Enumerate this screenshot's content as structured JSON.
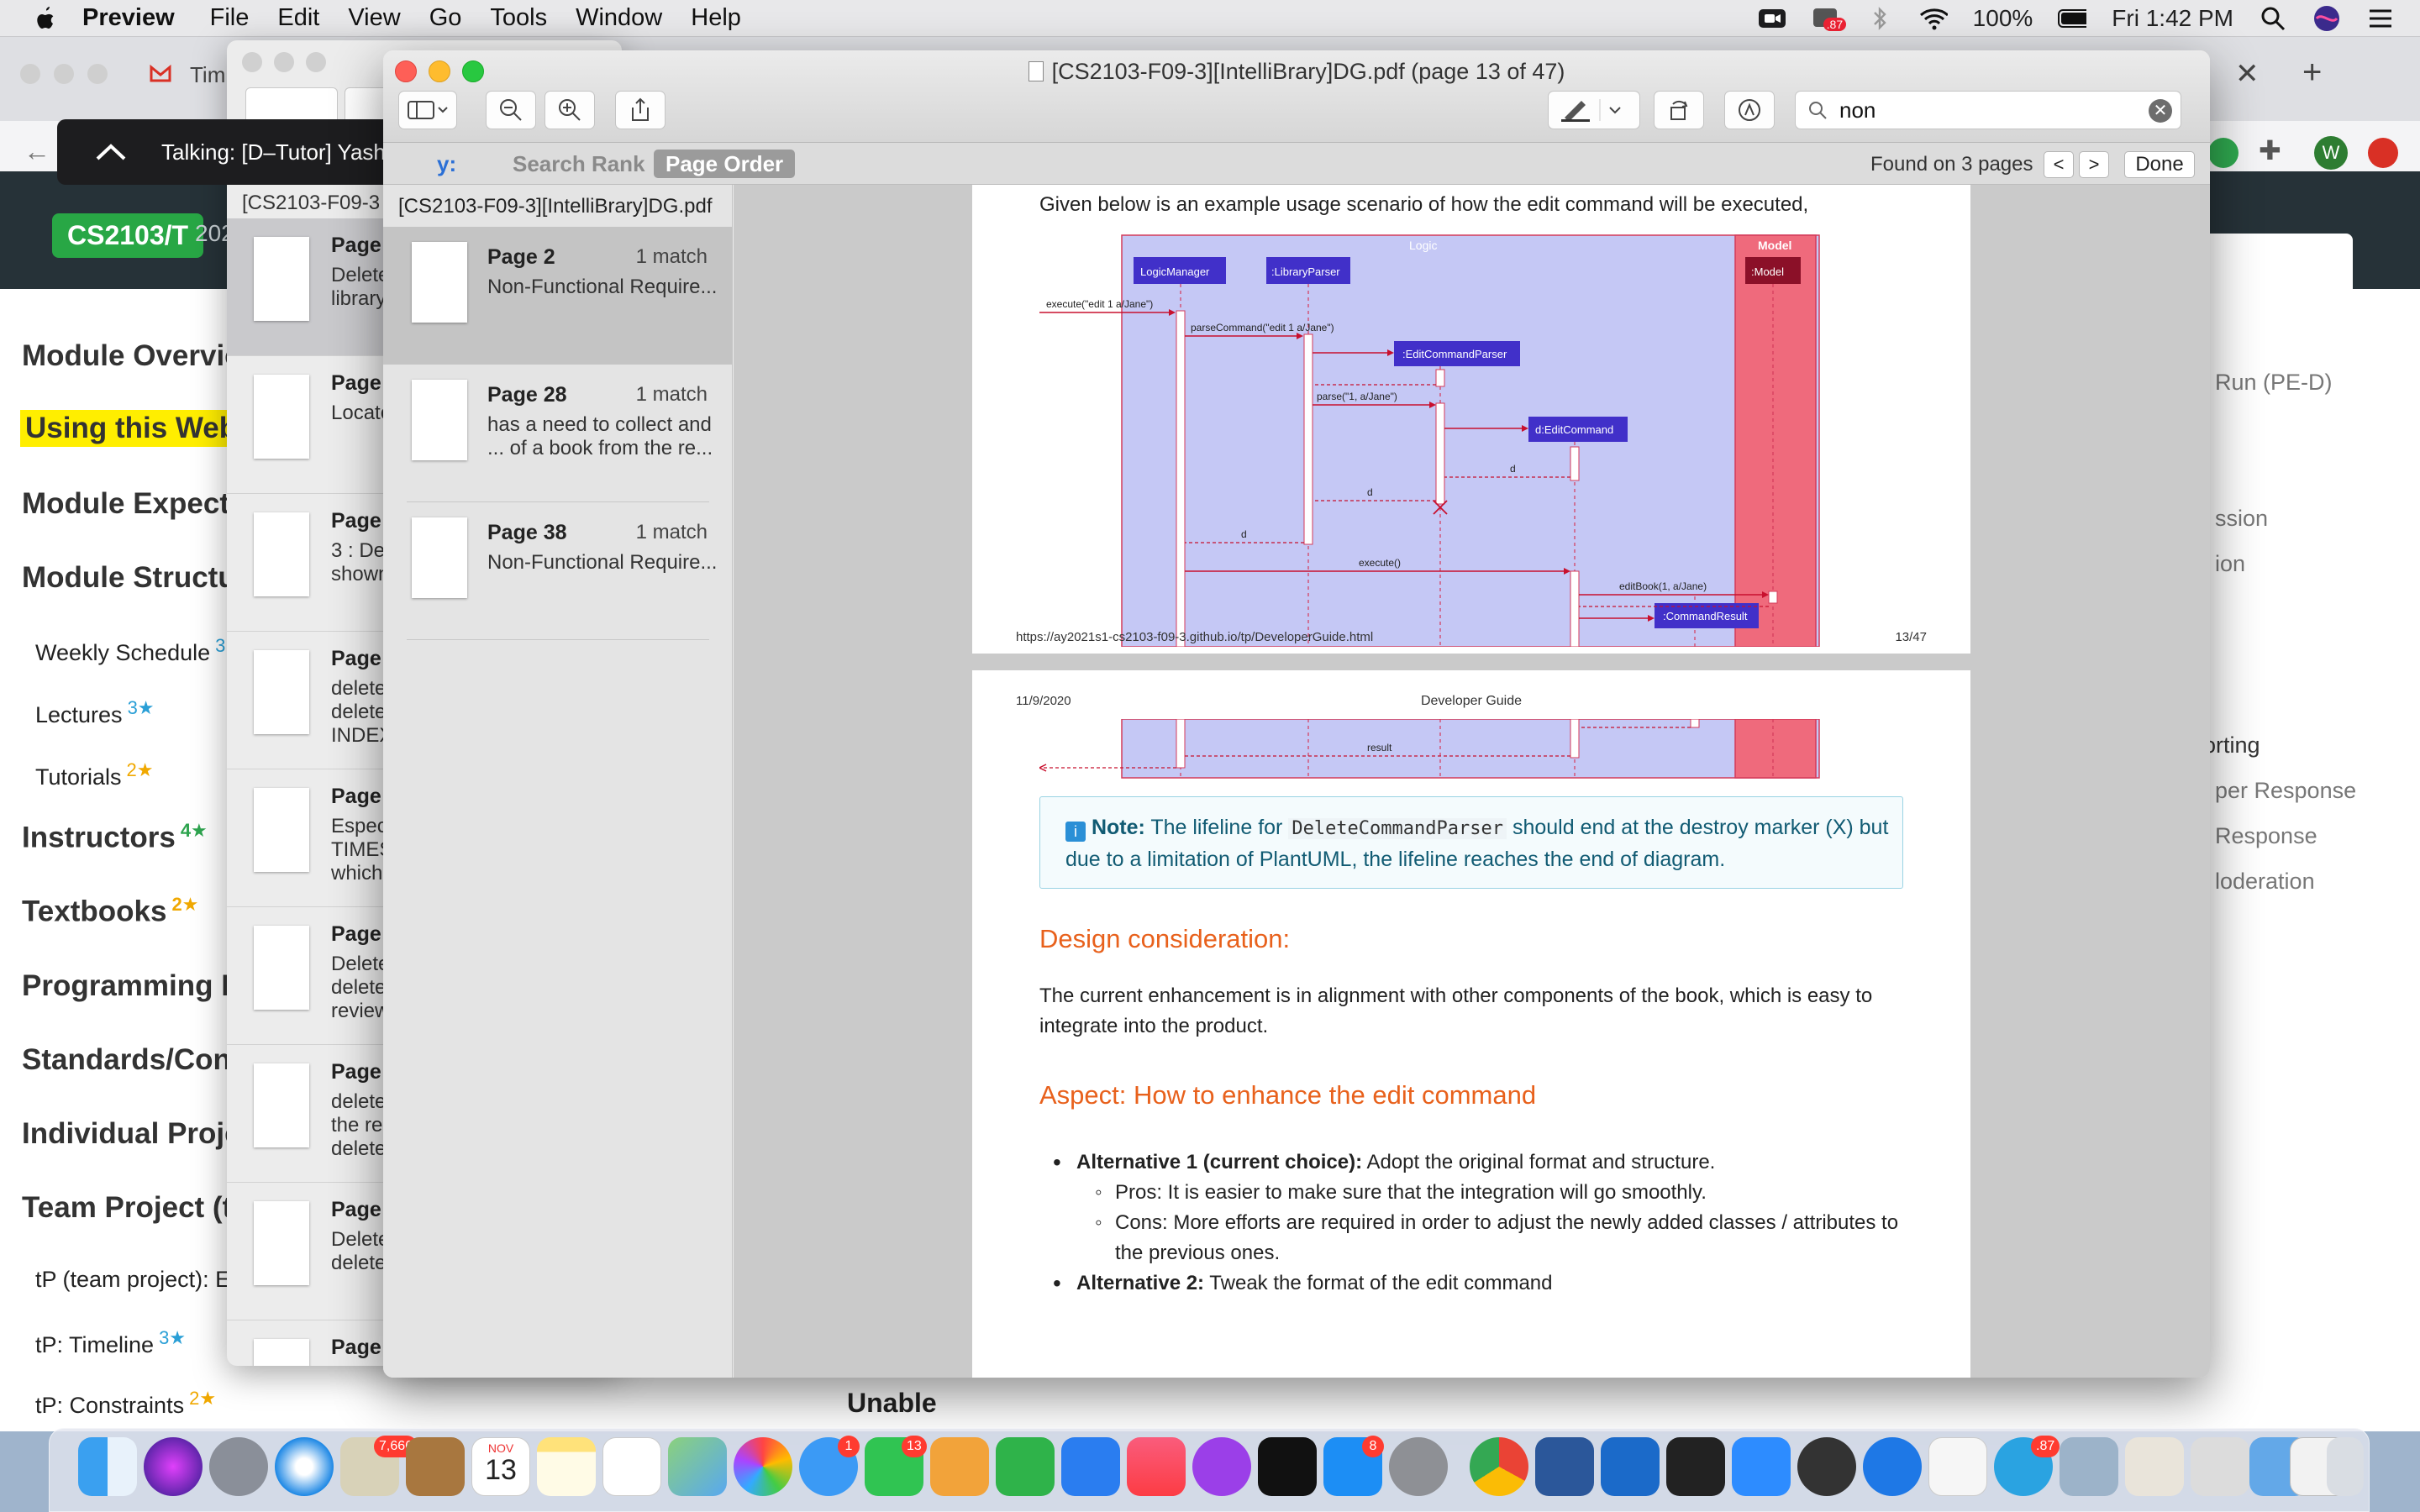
{
  "menubar": {
    "app_name": "Preview",
    "items": [
      "File",
      "Edit",
      "View",
      "Go",
      "Tools",
      "Window",
      "Help"
    ],
    "battery": "100%",
    "clock": "Fri 1:42 PM",
    "zoom_badge": ".87"
  },
  "browser": {
    "tab_title": "Tim",
    "site_badge": "CS2103/T",
    "site_badge_suffix": "202",
    "left_nav": [
      {
        "label": "Module Overvie",
        "kind": "h"
      },
      {
        "label": "Using this Web",
        "kind": "hl"
      },
      {
        "label": "Module Expecta",
        "kind": "h"
      },
      {
        "label": "Module Structu",
        "kind": "h"
      },
      {
        "label": "Weekly Schedule",
        "kind": "s",
        "stars": "3"
      },
      {
        "label": "Lectures",
        "kind": "s",
        "stars": "3★"
      },
      {
        "label": "Tutorials",
        "kind": "s",
        "stars": "2★"
      },
      {
        "label": "Instructors",
        "kind": "h",
        "stars": "4★"
      },
      {
        "label": "Textbooks",
        "kind": "h",
        "stars": "2★"
      },
      {
        "label": "Programming La",
        "kind": "h"
      },
      {
        "label": "Standards/Conv",
        "kind": "h"
      },
      {
        "label": "Individual Proje",
        "kind": "h"
      },
      {
        "label": "Team Project (tl",
        "kind": "h"
      },
      {
        "label": "tP (team project): E",
        "kind": "s"
      },
      {
        "label": "tP: Timeline",
        "kind": "s",
        "stars": "3★"
      },
      {
        "label": "tP: Constraints",
        "kind": "s",
        "stars": "2★"
      }
    ],
    "right_nav": [
      "Run (PE-D)",
      "ssion",
      "ion",
      ")",
      "orting",
      "per Response",
      "Response",
      "loderation"
    ],
    "bottom_text": "Unable",
    "avatar_letter": "W"
  },
  "notification": {
    "text": "Talking: [D–Tutor] Yash Sinha"
  },
  "back_window": {
    "title": "[CS2103-F09-3",
    "items": [
      {
        "page": "Page",
        "excerpt": "Delete\nlibrary"
      },
      {
        "page": "Page",
        "excerpt": "Locate"
      },
      {
        "page": "Page",
        "excerpt": "3 : De\nshown"
      },
      {
        "page": "Page",
        "excerpt": "delete\ndelete\nINDEX"
      },
      {
        "page": "Page",
        "excerpt": "Especi\nTIMES\nwhich"
      },
      {
        "page": "Page",
        "excerpt": "Delete\ndelete\nreview"
      },
      {
        "page": "Page",
        "excerpt": "delete\nthe re\ndelete"
      },
      {
        "page": "Page",
        "excerpt": "Delete\ndelete"
      },
      {
        "page": "Page",
        "excerpt": ""
      }
    ]
  },
  "window": {
    "title": "[CS2103-F09-3][IntelliBrary]DG.pdf (page 13 of 47)",
    "search_value": "non",
    "sort_by_label": "y:",
    "sort_options": [
      "Search Rank",
      "Page Order"
    ],
    "found_text": "Found on 3 pages",
    "prev_label": "<",
    "next_label": ">",
    "done_label": "Done"
  },
  "sidebar": {
    "document": "[CS2103-F09-3][IntelliBrary]DG.pdf",
    "results": [
      {
        "page": "Page 2",
        "count": "1 match",
        "excerpt": "Non-Functional Require..."
      },
      {
        "page": "Page 28",
        "count": "1 match",
        "excerpt": "has a need to collect and\n... of a book from the re..."
      },
      {
        "page": "Page 38",
        "count": "1 match",
        "excerpt": "Non-Functional Require..."
      }
    ]
  },
  "pdf": {
    "page13": {
      "intro": "Given below is an example usage scenario of how the edit command will be executed,",
      "footer_url": "https://ay2021s1-cs2103-f09-3.github.io/tp/DeveloperGuide.html",
      "footer_page": "13/47",
      "diagram": {
        "frame_logic": "Logic",
        "frame_model": "Model",
        "participants": [
          "LogicManager",
          ":LibraryParser",
          ":EditCommandParser",
          "d:EditCommand",
          ":Model",
          ":CommandResult"
        ],
        "messages": [
          "execute(\"edit 1 a/Jane\")",
          "parseCommand(\"edit 1 a/Jane\")",
          "parse(\"1, a/Jane\")",
          "d",
          "d",
          "d",
          "execute()",
          "editBook(1, a/Jane)"
        ]
      }
    },
    "page14": {
      "header_date": "11/9/2020",
      "header_title": "Developer Guide",
      "diagram_result": "result",
      "note_label": "Note:",
      "note_pre": "The lifeline for",
      "note_code": "DeleteCommandParser",
      "note_post": "should end at the destroy marker (X) but",
      "note_line2": "due to a limitation of PlantUML, the lifeline reaches the end of diagram.",
      "h_design": "Design consideration:",
      "design_para_1": "The current enhancement is in alignment with other components of the book, which is easy to",
      "design_para_2": "integrate into the product.",
      "h_aspect": "Aspect: How to enhance the edit command",
      "alt1_label": "Alternative 1 (current choice):",
      "alt1_text": "Adopt the original format and structure.",
      "alt1_pros": "Pros: It is easier to make sure that the integration will go smoothly.",
      "alt1_cons_1": "Cons: More efforts are required in order to adjust the newly added classes / attributes to",
      "alt1_cons_2": "the previous ones.",
      "alt2_label": "Alternative 2:",
      "alt2_text": "Tweak the format of the edit command"
    }
  },
  "dock": {
    "badges": {
      "photos": "7,666",
      "calendar_month": "NOV",
      "calendar_day": "13",
      "messages": "1",
      "facetime": "13",
      "appstore": "8",
      "telegram": ".87"
    },
    "apps": [
      "finder-icon",
      "siri-icon",
      "launchpad-icon",
      "safari-icon",
      "photos-icon",
      "contacts-icon",
      "calendar-icon",
      "notes-icon",
      "reminders-icon",
      "maps-icon",
      "photos-app-icon",
      "messages-icon",
      "facetime-icon",
      "keynote-icon",
      "numbers-icon",
      "pages-icon",
      "music-icon",
      "podcasts-icon",
      "tv-icon",
      "appstore-icon",
      "settings-icon",
      "chrome-icon",
      "word-icon",
      "xcode-icon",
      "terminal-icon",
      "zoom-icon",
      "quicktime-icon",
      "maps-pin-icon",
      "textedit-icon",
      "telegram-icon",
      "preview-icon",
      "coffee-icon",
      "pencil-icon",
      "folder-icon",
      "document-icon",
      "trash-icon"
    ]
  }
}
